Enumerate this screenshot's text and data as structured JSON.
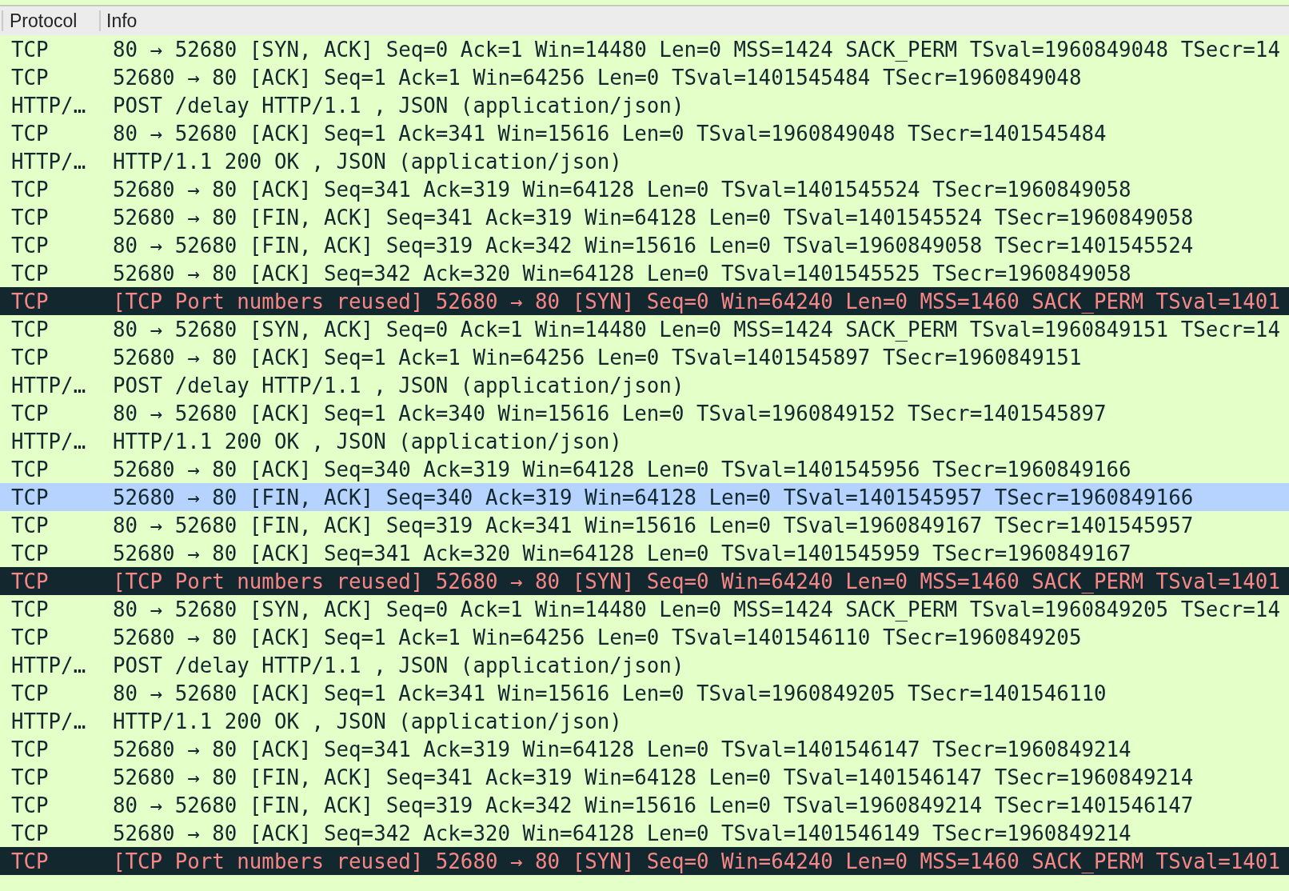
{
  "columns": [
    "Protocol",
    "Info"
  ],
  "rows": [
    {
      "kind": "normal",
      "selected": false,
      "protocol": "TCP",
      "info": "80 → 52680 [SYN, ACK] Seq=0 Ack=1 Win=14480 Len=0 MSS=1424 SACK_PERM TSval=1960849048 TSecr=14"
    },
    {
      "kind": "normal",
      "selected": false,
      "protocol": "TCP",
      "info": "52680 → 80 [ACK] Seq=1 Ack=1 Win=64256 Len=0 TSval=1401545484 TSecr=1960849048"
    },
    {
      "kind": "normal",
      "selected": false,
      "protocol": "HTTP/…",
      "info": "POST /delay HTTP/1.1 , JSON (application/json)"
    },
    {
      "kind": "normal",
      "selected": false,
      "protocol": "TCP",
      "info": "80 → 52680 [ACK] Seq=1 Ack=341 Win=15616 Len=0 TSval=1960849048 TSecr=1401545484"
    },
    {
      "kind": "normal",
      "selected": false,
      "protocol": "HTTP/…",
      "info": "HTTP/1.1 200 OK , JSON (application/json)"
    },
    {
      "kind": "normal",
      "selected": false,
      "protocol": "TCP",
      "info": "52680 → 80 [ACK] Seq=341 Ack=319 Win=64128 Len=0 TSval=1401545524 TSecr=1960849058"
    },
    {
      "kind": "normal",
      "selected": false,
      "protocol": "TCP",
      "info": "52680 → 80 [FIN, ACK] Seq=341 Ack=319 Win=64128 Len=0 TSval=1401545524 TSecr=1960849058"
    },
    {
      "kind": "normal",
      "selected": false,
      "protocol": "TCP",
      "info": "80 → 52680 [FIN, ACK] Seq=319 Ack=342 Win=15616 Len=0 TSval=1960849058 TSecr=1401545524"
    },
    {
      "kind": "normal",
      "selected": false,
      "protocol": "TCP",
      "info": "52680 → 80 [ACK] Seq=342 Ack=320 Win=64128 Len=0 TSval=1401545525 TSecr=1960849058"
    },
    {
      "kind": "error",
      "selected": false,
      "protocol": "TCP",
      "info": "[TCP Port numbers reused] 52680 → 80 [SYN] Seq=0 Win=64240 Len=0 MSS=1460 SACK_PERM TSval=1401"
    },
    {
      "kind": "normal",
      "selected": false,
      "protocol": "TCP",
      "info": "80 → 52680 [SYN, ACK] Seq=0 Ack=1 Win=14480 Len=0 MSS=1424 SACK_PERM TSval=1960849151 TSecr=14"
    },
    {
      "kind": "normal",
      "selected": false,
      "protocol": "TCP",
      "info": "52680 → 80 [ACK] Seq=1 Ack=1 Win=64256 Len=0 TSval=1401545897 TSecr=1960849151"
    },
    {
      "kind": "normal",
      "selected": false,
      "protocol": "HTTP/…",
      "info": "POST /delay HTTP/1.1 , JSON (application/json)"
    },
    {
      "kind": "normal",
      "selected": false,
      "protocol": "TCP",
      "info": "80 → 52680 [ACK] Seq=1 Ack=340 Win=15616 Len=0 TSval=1960849152 TSecr=1401545897"
    },
    {
      "kind": "normal",
      "selected": false,
      "protocol": "HTTP/…",
      "info": "HTTP/1.1 200 OK , JSON (application/json)"
    },
    {
      "kind": "normal",
      "selected": false,
      "protocol": "TCP",
      "info": "52680 → 80 [ACK] Seq=340 Ack=319 Win=64128 Len=0 TSval=1401545956 TSecr=1960849166"
    },
    {
      "kind": "normal",
      "selected": true,
      "protocol": "TCP",
      "info": "52680 → 80 [FIN, ACK] Seq=340 Ack=319 Win=64128 Len=0 TSval=1401545957 TSecr=1960849166"
    },
    {
      "kind": "normal",
      "selected": false,
      "protocol": "TCP",
      "info": "80 → 52680 [FIN, ACK] Seq=319 Ack=341 Win=15616 Len=0 TSval=1960849167 TSecr=1401545957"
    },
    {
      "kind": "normal",
      "selected": false,
      "protocol": "TCP",
      "info": "52680 → 80 [ACK] Seq=341 Ack=320 Win=64128 Len=0 TSval=1401545959 TSecr=1960849167"
    },
    {
      "kind": "error",
      "selected": false,
      "protocol": "TCP",
      "info": "[TCP Port numbers reused] 52680 → 80 [SYN] Seq=0 Win=64240 Len=0 MSS=1460 SACK_PERM TSval=1401"
    },
    {
      "kind": "normal",
      "selected": false,
      "protocol": "TCP",
      "info": "80 → 52680 [SYN, ACK] Seq=0 Ack=1 Win=14480 Len=0 MSS=1424 SACK_PERM TSval=1960849205 TSecr=14"
    },
    {
      "kind": "normal",
      "selected": false,
      "protocol": "TCP",
      "info": "52680 → 80 [ACK] Seq=1 Ack=1 Win=64256 Len=0 TSval=1401546110 TSecr=1960849205"
    },
    {
      "kind": "normal",
      "selected": false,
      "protocol": "HTTP/…",
      "info": "POST /delay HTTP/1.1 , JSON (application/json)"
    },
    {
      "kind": "normal",
      "selected": false,
      "protocol": "TCP",
      "info": "80 → 52680 [ACK] Seq=1 Ack=341 Win=15616 Len=0 TSval=1960849205 TSecr=1401546110"
    },
    {
      "kind": "normal",
      "selected": false,
      "protocol": "HTTP/…",
      "info": "HTTP/1.1 200 OK , JSON (application/json)"
    },
    {
      "kind": "normal",
      "selected": false,
      "protocol": "TCP",
      "info": "52680 → 80 [ACK] Seq=341 Ack=319 Win=64128 Len=0 TSval=1401546147 TSecr=1960849214"
    },
    {
      "kind": "normal",
      "selected": false,
      "protocol": "TCP",
      "info": "52680 → 80 [FIN, ACK] Seq=341 Ack=319 Win=64128 Len=0 TSval=1401546147 TSecr=1960849214"
    },
    {
      "kind": "normal",
      "selected": false,
      "protocol": "TCP",
      "info": "80 → 52680 [FIN, ACK] Seq=319 Ack=342 Win=15616 Len=0 TSval=1960849214 TSecr=1401546147"
    },
    {
      "kind": "normal",
      "selected": false,
      "protocol": "TCP",
      "info": "52680 → 80 [ACK] Seq=342 Ack=320 Win=64128 Len=0 TSval=1401546149 TSecr=1960849214"
    },
    {
      "kind": "error",
      "selected": false,
      "protocol": "TCP",
      "info": "[TCP Port numbers reused] 52680 → 80 [SYN] Seq=0 Win=64240 Len=0 MSS=1460 SACK_PERM TSval=1401"
    }
  ]
}
